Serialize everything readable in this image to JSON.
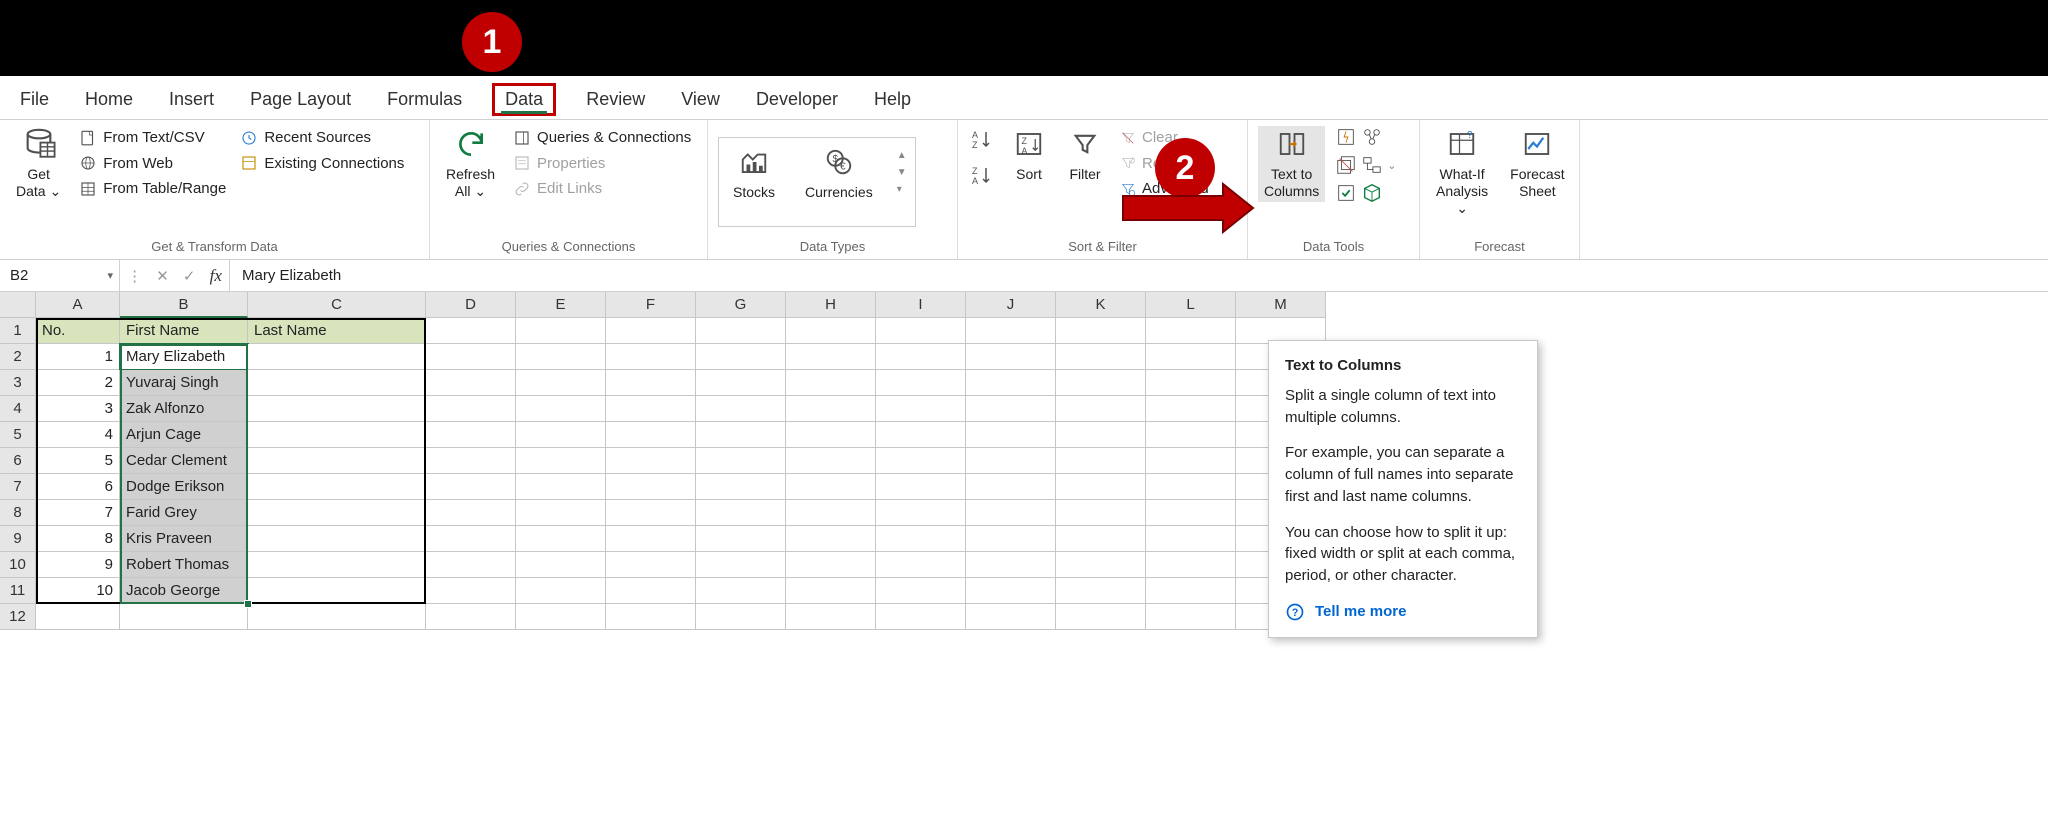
{
  "callouts": {
    "one": "1",
    "two": "2"
  },
  "tabs": {
    "file": "File",
    "home": "Home",
    "insert": "Insert",
    "pageLayout": "Page Layout",
    "formulas": "Formulas",
    "data": "Data",
    "review": "Review",
    "view": "View",
    "developer": "Developer",
    "help": "Help"
  },
  "activeTab": "Data",
  "ribbon": {
    "getData": {
      "label": "Get Data ⌄",
      "big": "Get\nData ⌄",
      "items": [
        "From Text/CSV",
        "From Web",
        "From Table/Range",
        "Recent Sources",
        "Existing Connections"
      ],
      "groupLabel": "Get & Transform Data"
    },
    "queries": {
      "refresh": "Refresh All ⌄",
      "items": [
        "Queries & Connections",
        "Properties",
        "Edit Links"
      ],
      "groupLabel": "Queries & Connections"
    },
    "dataTypes": {
      "stocks": "Stocks",
      "currencies": "Currencies",
      "groupLabel": "Data Types"
    },
    "sortFilter": {
      "sort": "Sort",
      "filter": "Filter",
      "clear": "Clear",
      "reapply": "Reapply",
      "advanced": "Advanced",
      "groupLabel": "Sort & Filter"
    },
    "dataTools": {
      "textToColumns": "Text to Columns",
      "groupLabel": "Data Tools"
    },
    "forecast": {
      "whatIf": "What-If Analysis ⌄",
      "forecastSheet": "Forecast Sheet",
      "groupLabel": "Forecast"
    }
  },
  "formulaBar": {
    "nameBox": "B2",
    "formula": "Mary Elizabeth"
  },
  "columns": [
    "A",
    "B",
    "C",
    "D",
    "E",
    "F",
    "G",
    "H",
    "I",
    "J",
    "K",
    "L",
    "M"
  ],
  "table": {
    "headers": {
      "no": "No.",
      "first": "First Name",
      "last": "Last Name"
    },
    "rows": [
      {
        "no": 1,
        "first": "Mary Elizabeth",
        "last": ""
      },
      {
        "no": 2,
        "first": "Yuvaraj Singh",
        "last": ""
      },
      {
        "no": 3,
        "first": "Zak Alfonzo",
        "last": ""
      },
      {
        "no": 4,
        "first": "Arjun Cage",
        "last": ""
      },
      {
        "no": 5,
        "first": "Cedar Clement",
        "last": ""
      },
      {
        "no": 6,
        "first": "Dodge Erikson",
        "last": ""
      },
      {
        "no": 7,
        "first": "Farid Grey",
        "last": ""
      },
      {
        "no": 8,
        "first": "Kris Praveen",
        "last": ""
      },
      {
        "no": 9,
        "first": "Robert Thomas",
        "last": ""
      },
      {
        "no": 10,
        "first": "Jacob George",
        "last": ""
      }
    ],
    "rowCountShown": 12
  },
  "tooltip": {
    "title": "Text to Columns",
    "p1": "Split a single column of text into multiple columns.",
    "p2": "For example, you can separate a column of full names into separate first and last name columns.",
    "p3": "You can choose how to split it up: fixed width or split at each comma, period, or other character.",
    "tellMore": "Tell me more"
  }
}
